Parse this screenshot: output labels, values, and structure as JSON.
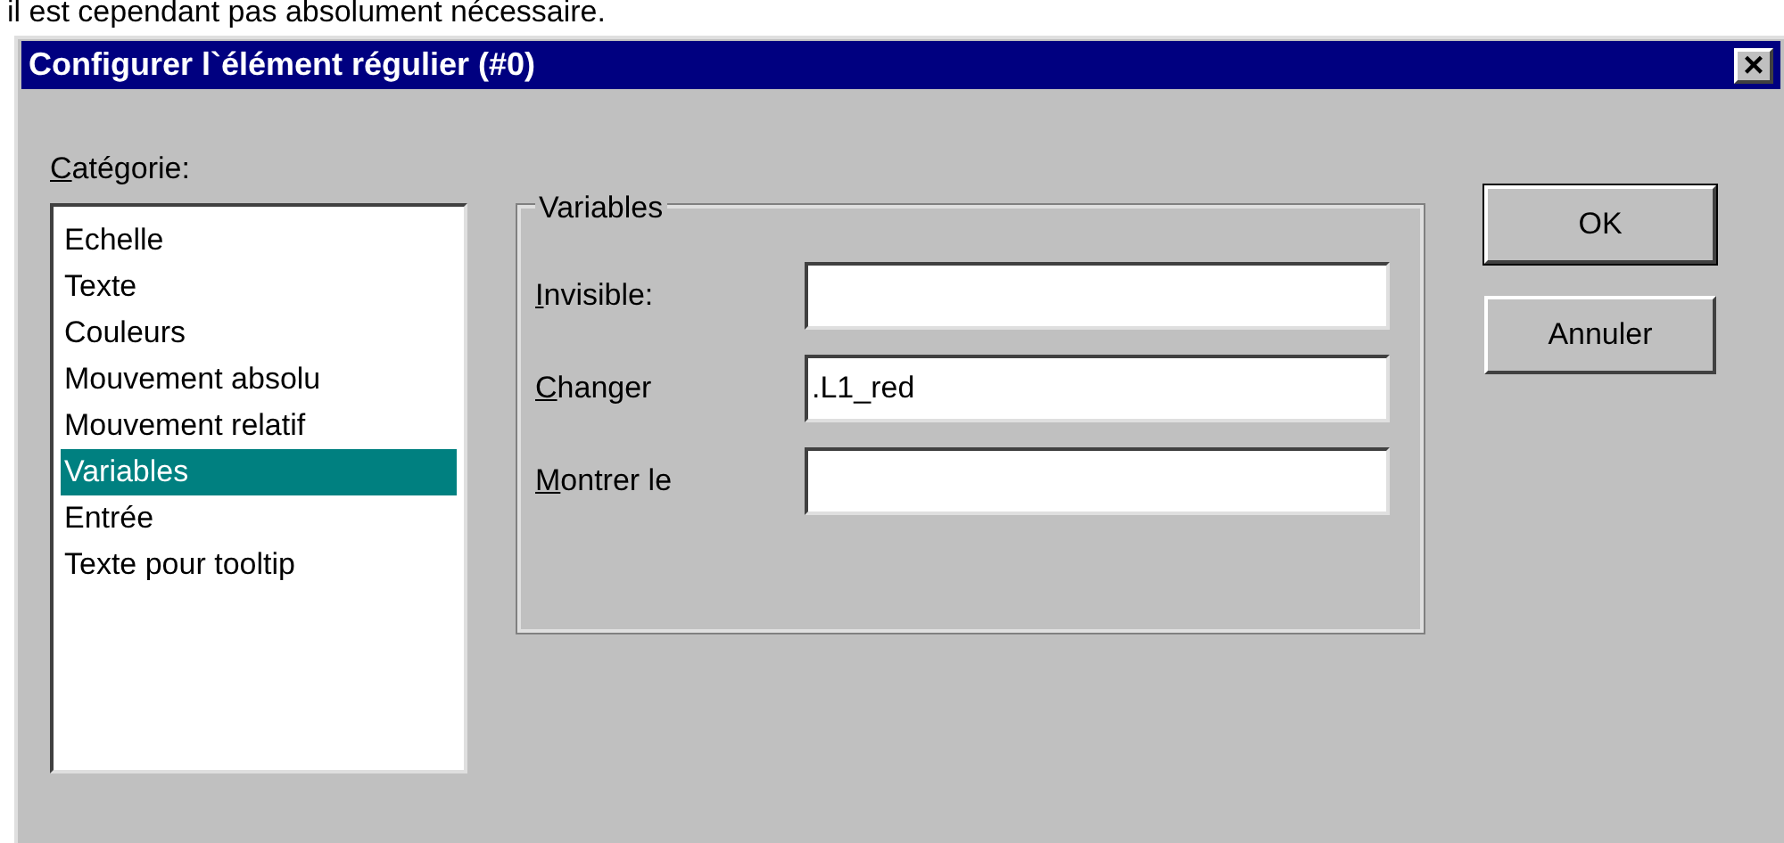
{
  "caption": "il est cependant pas absolument nécessaire.",
  "window": {
    "title": "Configurer l`élément régulier (#0)",
    "close": "×"
  },
  "category": {
    "label": "Catégorie:",
    "items": [
      {
        "label": "Echelle",
        "selected": false
      },
      {
        "label": "Texte",
        "selected": false
      },
      {
        "label": "Couleurs",
        "selected": false
      },
      {
        "label": "Mouvement absolu",
        "selected": false
      },
      {
        "label": "Mouvement relatif",
        "selected": false
      },
      {
        "label": "Variables",
        "selected": true
      },
      {
        "label": "Entrée",
        "selected": false
      },
      {
        "label": "Texte pour tooltip",
        "selected": false
      }
    ]
  },
  "group": {
    "title": "Variables",
    "fields": [
      {
        "label": "Invisible:"
      },
      {
        "label": "Changer",
        "value": ".L1_red"
      },
      {
        "label": "Montrer le"
      }
    ]
  },
  "buttons": [
    "OK",
    "Annuler"
  ]
}
